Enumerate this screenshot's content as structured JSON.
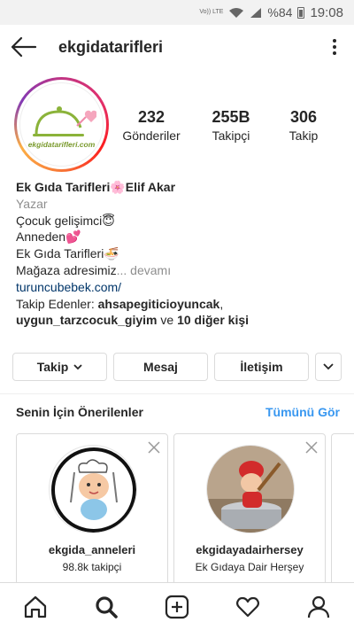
{
  "status_bar": {
    "network": "Vo)) LTE",
    "battery": "%84",
    "time": "19:08"
  },
  "header": {
    "username": "ekgidatarifleri",
    "back_icon": "arrow-left-icon",
    "more_icon": "more-vertical-icon"
  },
  "profile": {
    "avatar_text": "ekgidatarifleri.com",
    "stats": [
      {
        "value": "232",
        "label": "Gönderiler"
      },
      {
        "value": "255B",
        "label": "Takipçi"
      },
      {
        "value": "306",
        "label": "Takip"
      }
    ],
    "name": "Ek Gıda Tarifleri🌸Elif Akar",
    "category": "Yazar",
    "bio_lines": [
      "Çocuk gelişimci😇",
      "Anneden💕",
      "Ek Gıda Tarifleri🍜"
    ],
    "bio_truncated": "Mağaza adresimiz",
    "more_label": "... devamı",
    "website": "turuncubebek.com/",
    "followed_by_prefix": "Takip Edenler: ",
    "followed_by_user1": "ahsapegiticioyuncak",
    "followed_by_sep": ",",
    "followed_by_user2": "uygun_tarzcocuk_giyim",
    "followed_by_and": " ve ",
    "followed_by_others": "10 diğer kişi"
  },
  "actions": {
    "follow": "Takip",
    "message": "Mesaj",
    "contact": "İletişim"
  },
  "suggestions": {
    "title": "Senin İçin Önerilenler",
    "see_all": "Tümünü Gör",
    "cards": [
      {
        "username": "ekgida_anneleri",
        "subtitle": "98.8k takipçi"
      },
      {
        "username": "ekgidayadairhersey",
        "subtitle": "Ek Gıdaya Dair Herşey"
      }
    ]
  },
  "bottom_nav": [
    "home-icon",
    "search-icon",
    "new-post-icon",
    "activity-heart-icon",
    "profile-icon"
  ],
  "colors": {
    "link_blue": "#3897f0",
    "text": "#262626",
    "muted": "#8e8e8e",
    "border": "#dbdbdb"
  }
}
